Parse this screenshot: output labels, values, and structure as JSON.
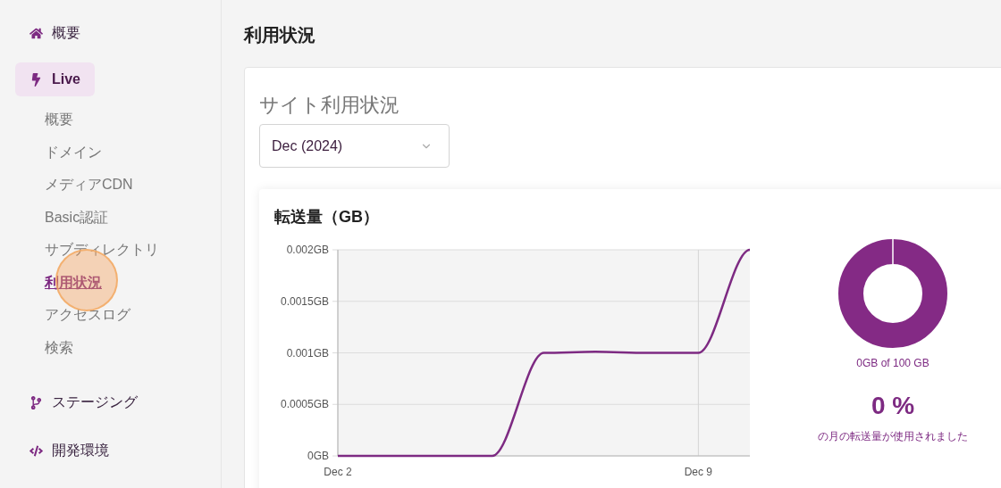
{
  "sidebar": {
    "items": [
      {
        "label": "概要",
        "selected": false
      },
      {
        "label": "Live",
        "selected": true,
        "children": [
          {
            "label": "概要",
            "selected": false
          },
          {
            "label": "ドメイン",
            "selected": false
          },
          {
            "label": "メディアCDN",
            "selected": false
          },
          {
            "label": "Basic認証",
            "selected": false
          },
          {
            "label": "サブディレクトリ",
            "selected": false
          },
          {
            "label": "利用状況",
            "selected": true
          },
          {
            "label": "アクセスログ",
            "selected": false
          },
          {
            "label": "検索",
            "selected": false
          }
        ]
      },
      {
        "label": "ステージング",
        "selected": false
      },
      {
        "label": "開発環境",
        "selected": false
      }
    ]
  },
  "page_title": "利用状況",
  "card": {
    "title": "サイト利用状況",
    "month_select": {
      "value": "Dec (2024)"
    },
    "transfer": {
      "title": "転送量（GB）",
      "chart_data": {
        "type": "line",
        "categories": [
          "Dec 2",
          null,
          null,
          null,
          null,
          null,
          null,
          "Dec 9",
          null
        ],
        "series": [
          {
            "color": "#7d2a82",
            "values": [
              0,
              0,
              0,
              0,
              0.001,
              0.00101,
              0.001,
              0.001,
              0.002
            ]
          }
        ],
        "ylim": [
          0,
          0.002
        ],
        "grid": true,
        "yticks": [
          {
            "value": 0,
            "label": "0GB"
          },
          {
            "value": 0.0005,
            "label": "0.0005GB"
          },
          {
            "value": 0.001,
            "label": "0.001GB"
          },
          {
            "value": 0.0015,
            "label": "0.0015GB"
          },
          {
            "value": 0.002,
            "label": "0.002GB"
          }
        ]
      },
      "usage": {
        "caption": "0GB of 100 GB",
        "percent": "0 %",
        "note": "の月の転送量が使用されました"
      }
    }
  }
}
